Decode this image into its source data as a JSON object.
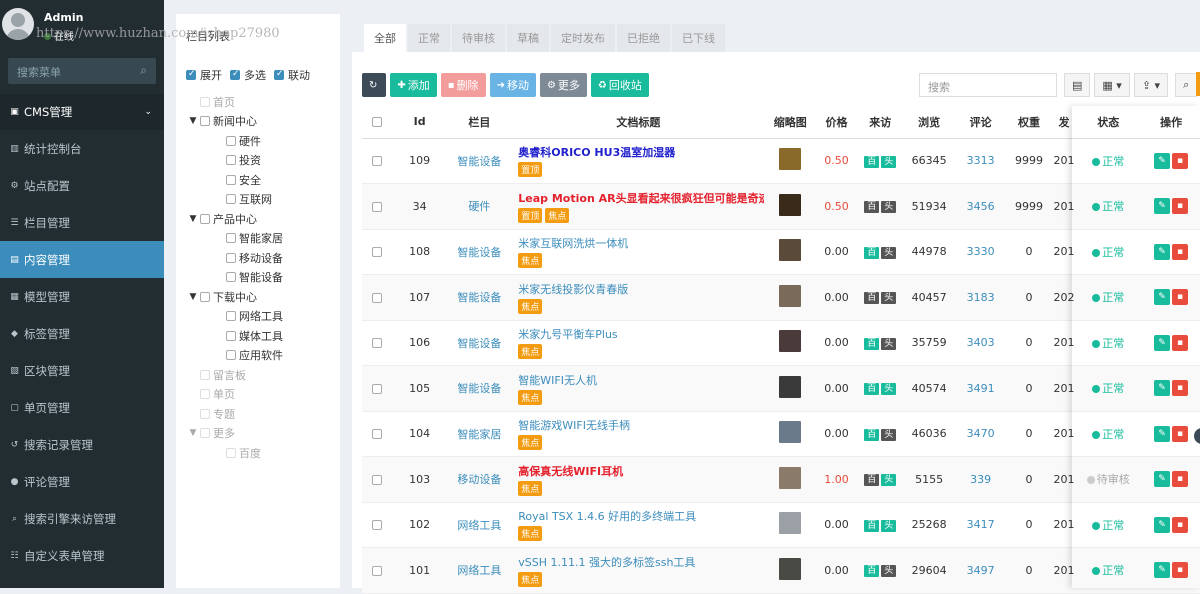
{
  "sidebar": {
    "user": {
      "name": "Admin",
      "status": "在线"
    },
    "search_placeholder": "搜索菜单",
    "menu": [
      {
        "label": "CMS管理",
        "icon": "file-icon",
        "head": true
      },
      {
        "label": "统计控制台",
        "icon": "chart-icon"
      },
      {
        "label": "站点配置",
        "icon": "gears-icon"
      },
      {
        "label": "栏目管理",
        "icon": "list-icon"
      },
      {
        "label": "内容管理",
        "icon": "file-text-icon",
        "active": true
      },
      {
        "label": "模型管理",
        "icon": "grid-icon"
      },
      {
        "label": "标签管理",
        "icon": "tag-icon"
      },
      {
        "label": "区块管理",
        "icon": "block-icon"
      },
      {
        "label": "单页管理",
        "icon": "page-icon"
      },
      {
        "label": "搜索记录管理",
        "icon": "history-icon"
      },
      {
        "label": "评论管理",
        "icon": "comment-icon"
      },
      {
        "label": "搜索引擎来访管理",
        "icon": "search-icon"
      },
      {
        "label": "自定义表单管理",
        "icon": "form-icon"
      }
    ]
  },
  "watermark": "https://www.huzhan.com/ishop27980",
  "tree": {
    "title": "栏目列表",
    "controls": {
      "expand": "展开",
      "select_all": "多选",
      "linkage": "联动"
    },
    "nodes": [
      {
        "label": "首页",
        "level": 0,
        "dim": true
      },
      {
        "label": "新闻中心",
        "level": 0,
        "arrow": true
      },
      {
        "label": "硬件",
        "level": 1
      },
      {
        "label": "投资",
        "level": 1
      },
      {
        "label": "安全",
        "level": 1
      },
      {
        "label": "互联网",
        "level": 1
      },
      {
        "label": "产品中心",
        "level": 0,
        "arrow": true
      },
      {
        "label": "智能家居",
        "level": 1
      },
      {
        "label": "移动设备",
        "level": 1
      },
      {
        "label": "智能设备",
        "level": 1
      },
      {
        "label": "下载中心",
        "level": 0,
        "arrow": true
      },
      {
        "label": "网络工具",
        "level": 1
      },
      {
        "label": "媒体工具",
        "level": 1
      },
      {
        "label": "应用软件",
        "level": 1
      },
      {
        "label": "留言板",
        "level": 0,
        "dim": true
      },
      {
        "label": "单页",
        "level": 0,
        "dim": true
      },
      {
        "label": "专题",
        "level": 0,
        "dim": true
      },
      {
        "label": "更多",
        "level": 0,
        "dim": true,
        "arrow": true
      },
      {
        "label": "百度",
        "level": 1,
        "dim": true
      }
    ]
  },
  "tabs": [
    "全部",
    "正常",
    "待审核",
    "草稿",
    "定时发布",
    "已拒绝",
    "已下线"
  ],
  "toolbar": {
    "refresh": "",
    "add": "添加",
    "delete": "删除",
    "move": "移动",
    "more": "更多",
    "recycle": "回收站",
    "search_placeholder": "搜索"
  },
  "columns": [
    "Id",
    "栏目",
    "文档标题",
    "缩略图",
    "价格",
    "来访",
    "浏览",
    "评论",
    "权重",
    "发",
    "状态",
    "操作"
  ],
  "flags": {
    "bai": "百",
    "tou": "头"
  },
  "rows": [
    {
      "id": "109",
      "cat": "智能设备",
      "title": "奥睿科ORICO HU3温室加湿器",
      "title_color": "#2222cc",
      "bold": true,
      "badges": [
        "置顶"
      ],
      "thumb": "#8a6a2a",
      "price": "0.50",
      "price_red": true,
      "flags": [
        "g",
        "g"
      ],
      "views": "66345",
      "comments": "3313",
      "weight": "9999",
      "pub": "201",
      "status": "正常",
      "pending": false
    },
    {
      "id": "34",
      "cat": "硬件",
      "title": "Leap Motion AR头显看起来很疯狂但可能是奇迹",
      "title_color": "#e4222e",
      "bold": true,
      "badges": [
        "置顶",
        "焦点"
      ],
      "thumb": "#3a2a1a",
      "price": "0.50",
      "price_red": true,
      "flags": [
        "d",
        "d"
      ],
      "views": "51934",
      "comments": "3456",
      "weight": "9999",
      "pub": "201",
      "status": "正常",
      "pending": false
    },
    {
      "id": "108",
      "cat": "智能设备",
      "title": "米家互联网洗烘一体机",
      "title_color": "#3c8dbc",
      "bold": false,
      "badges": [
        "焦点"
      ],
      "thumb": "#5a4a3a",
      "price": "0.00",
      "price_red": false,
      "flags": [
        "g",
        "d"
      ],
      "views": "44978",
      "comments": "3330",
      "weight": "0",
      "pub": "201",
      "status": "正常",
      "pending": false
    },
    {
      "id": "107",
      "cat": "智能设备",
      "title": "米家无线投影仪青春版",
      "title_color": "#3c8dbc",
      "bold": false,
      "badges": [
        "焦点"
      ],
      "thumb": "#7a6a5a",
      "price": "0.00",
      "price_red": false,
      "flags": [
        "d",
        "d"
      ],
      "views": "40457",
      "comments": "3183",
      "weight": "0",
      "pub": "202",
      "status": "正常",
      "pending": false
    },
    {
      "id": "106",
      "cat": "智能设备",
      "title": "米家九号平衡车Plus",
      "title_color": "#3c8dbc",
      "bold": false,
      "badges": [
        "焦点"
      ],
      "thumb": "#4a3a3a",
      "price": "0.00",
      "price_red": false,
      "flags": [
        "g",
        "d"
      ],
      "views": "35759",
      "comments": "3403",
      "weight": "0",
      "pub": "201",
      "status": "正常",
      "pending": false
    },
    {
      "id": "105",
      "cat": "智能设备",
      "title": "智能WIFI无人机",
      "title_color": "#3c8dbc",
      "bold": false,
      "badges": [
        "焦点"
      ],
      "thumb": "#3a3a3a",
      "price": "0.00",
      "price_red": false,
      "flags": [
        "g",
        "g"
      ],
      "views": "40574",
      "comments": "3491",
      "weight": "0",
      "pub": "201",
      "status": "正常",
      "pending": false
    },
    {
      "id": "104",
      "cat": "智能家居",
      "title": "智能游戏WIFI无线手柄",
      "title_color": "#3c8dbc",
      "bold": false,
      "badges": [
        "焦点"
      ],
      "thumb": "#6a7a8a",
      "price": "0.00",
      "price_red": false,
      "flags": [
        "g",
        "d"
      ],
      "views": "46036",
      "comments": "3470",
      "weight": "0",
      "pub": "201",
      "status": "正常",
      "pending": false
    },
    {
      "id": "103",
      "cat": "移动设备",
      "title": "高保真无线WIFI耳机",
      "title_color": "#e4222e",
      "bold": true,
      "badges": [
        "焦点"
      ],
      "thumb": "#8a7a6a",
      "price": "1.00",
      "price_red": true,
      "flags": [
        "d",
        "g"
      ],
      "views": "5155",
      "comments": "339",
      "weight": "0",
      "pub": "201",
      "status": "待审核",
      "pending": true
    },
    {
      "id": "102",
      "cat": "网络工具",
      "title": "Royal TSX 1.4.6 好用的多终端工具",
      "title_color": "#3c8dbc",
      "bold": false,
      "badges": [
        "焦点"
      ],
      "thumb": "#9aa0a6",
      "price": "0.00",
      "price_red": false,
      "flags": [
        "g",
        "g"
      ],
      "views": "25268",
      "comments": "3417",
      "weight": "0",
      "pub": "201",
      "status": "正常",
      "pending": false
    },
    {
      "id": "101",
      "cat": "网络工具",
      "title": "vSSH 1.11.1 强大的多标签ssh工具",
      "title_color": "#3c8dbc",
      "bold": false,
      "badges": [
        "焦点"
      ],
      "thumb": "#4a4a44",
      "price": "0.00",
      "price_red": false,
      "flags": [
        "g",
        "d"
      ],
      "views": "29604",
      "comments": "3497",
      "weight": "0",
      "pub": "201",
      "status": "正常",
      "pending": false
    }
  ]
}
